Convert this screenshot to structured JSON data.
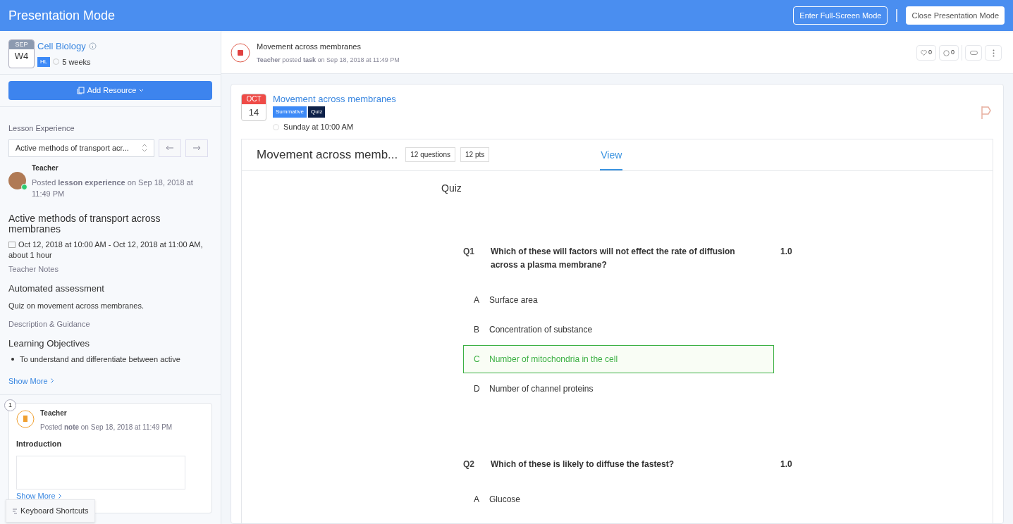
{
  "header": {
    "title": "Presentation Mode",
    "buttons": [
      "Enter Full-Screen Mode",
      "Close Presentation Mode"
    ]
  },
  "sidebar": {
    "unit": {
      "month": "SEP",
      "week": "W4",
      "title": "Cell Biology",
      "badge": "HL",
      "duration": "5 weeks"
    },
    "add_button": "Add Resource",
    "lesson_label": "Lesson Experience",
    "lesson_select": "Active methods of transport acr...",
    "post": {
      "author": "Teacher",
      "text": "Posted **lesson experience** on Sep 18, 2018 at 11:49 PM",
      "online": true
    },
    "lesson_title": "Active methods of transport across membranes",
    "date": "Oct 12, 2018 at 10:00 AM - Oct 12, 2018 at 11:00 AM, about 1 hour",
    "teacher_notes": "Teacher Notes",
    "assessment_title": "Automated assessment",
    "assessment_text": "Quiz on movement across membranes.",
    "guidance": "Description & Guidance",
    "objectives_title": "Learning Objectives",
    "objectives": [
      "To understand and differentiate between active"
    ],
    "show_more": "Show More",
    "note": {
      "index": "1",
      "author": "Teacher",
      "text": "Posted **note** on Sep 18, 2018 at 11:49 PM",
      "title": "Introduction",
      "show_more": "Show More"
    },
    "shortcuts": "Keyboard Shortcuts"
  },
  "post": {
    "title": "Movement across membranes",
    "meta": "**Teacher** posted **task** on Sep 18, 2018 at 11:49 PM",
    "likes": "0",
    "comments": "0"
  },
  "task": {
    "month": "OCT",
    "day": "14",
    "title": "Movement across membranes",
    "tags": [
      {
        "label": "Summative",
        "color": "#3d8af7"
      },
      {
        "label": "Quiz",
        "color": "#0d2149"
      }
    ],
    "due": "Sunday at 10:00 AM",
    "quiz_title": "Movement across memb...",
    "questions_count": "12 questions",
    "points": "12 pts",
    "tabs": [
      {
        "label": "View",
        "selected": true
      }
    ],
    "heading": "Quiz",
    "questions": [
      {
        "number": "Q1",
        "text": "Which of these will factors will not effect the rate of diffusion across a plasma membrane?",
        "points": "1.0",
        "answers": [
          {
            "letter": "A",
            "text": "Surface area",
            "correct": false
          },
          {
            "letter": "B",
            "text": "Concentration of substance",
            "correct": false
          },
          {
            "letter": "C",
            "text": "Number of mitochondria in the cell",
            "correct": true
          },
          {
            "letter": "D",
            "text": "Number of channel proteins",
            "correct": false
          }
        ]
      },
      {
        "number": "Q2",
        "text": "Which of these is likely to diffuse the fastest?",
        "points": "1.0",
        "answers": [
          {
            "letter": "A",
            "text": "Glucose",
            "correct": false
          }
        ]
      }
    ]
  }
}
